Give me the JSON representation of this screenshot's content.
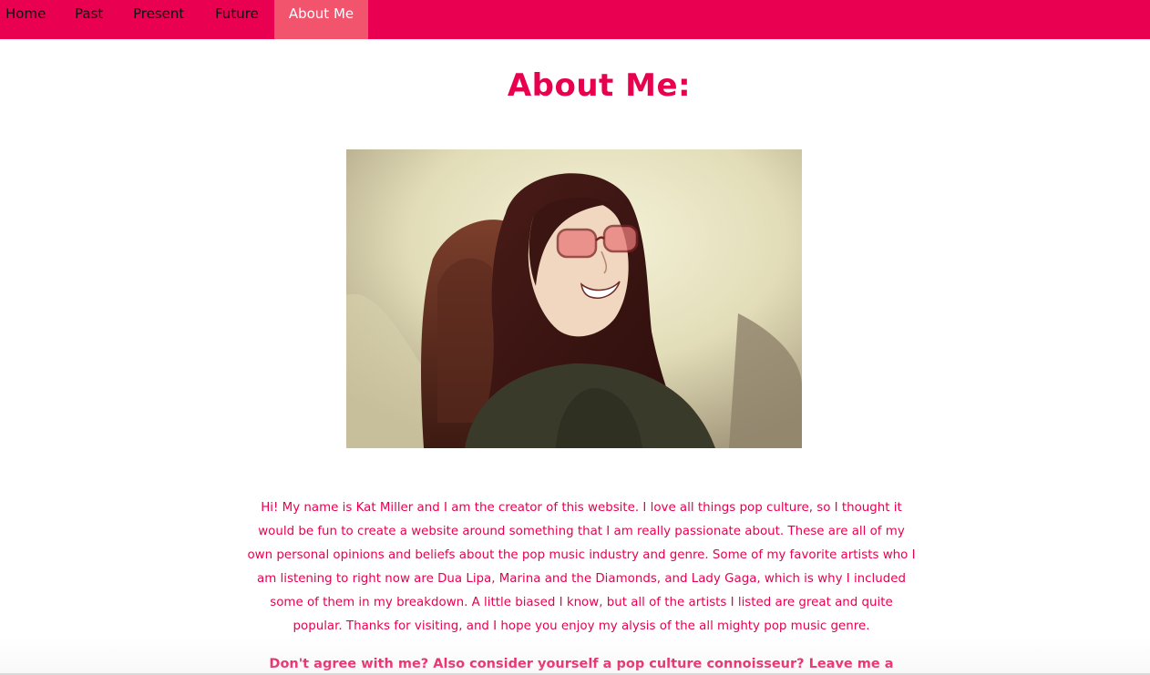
{
  "nav": {
    "items": [
      {
        "label": "Home"
      },
      {
        "label": "Past"
      },
      {
        "label": "Present"
      },
      {
        "label": "Future"
      },
      {
        "label": "About Me",
        "active": true
      }
    ]
  },
  "page": {
    "title": "About Me:",
    "photo_icon": "portrait-illustration",
    "bio": "Hi! My name is Kat Miller and I am the creator of this website. I love all things pop culture, so I thought it would be fun to create a website around something that I am really passionate about. These are all of my own personal opinions and beliefs about the pop music industry and genre. Some of my favorite artists who I am listening to right now are Dua Lipa, Marina and the Diamonds, and Lady Gaga, which is why I included some of them in my breakdown. A little biased I know, but all of the artists I listed are great and quite popular. Thanks for visiting, and I hope you enjoy my alysis of the all mighty pop music genre.",
    "cta": "Don't agree with me? Also consider yourself a pop culture connoisseur? Leave me a"
  },
  "colors": {
    "nav_bg": "#ea0050",
    "nav_active_bg": "#f2546d",
    "accent_text": "#e8004f"
  }
}
